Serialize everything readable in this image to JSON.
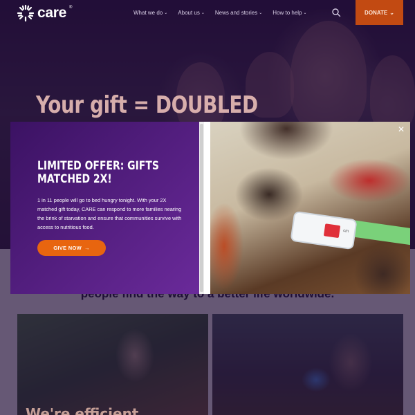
{
  "header": {
    "logo_text": "care",
    "logo_tm": "®",
    "nav": [
      {
        "label": "What we do"
      },
      {
        "label": "About us"
      },
      {
        "label": "News and stories"
      },
      {
        "label": "How to help"
      }
    ],
    "nav_caret": "⌄",
    "donate_label": "DONATE",
    "donate_caret": "⌄"
  },
  "hero": {
    "headline": "Your gift = DOUBLED"
  },
  "mission": {
    "text": "people find the way to a better life worldwide."
  },
  "cards": [
    {
      "heading": "We're efficient"
    },
    {
      "heading": ""
    }
  ],
  "modal": {
    "title": "LIMITED OFFER: GIFTS MATCHED 2X!",
    "body": "1 in 11 people will go to bed hungry tonight. With your 2X matched gift today, CARE can respond to more families nearing the brink of starvation and ensure that communities survive with access to nutritious food.",
    "cta_label": "GIVE NOW",
    "cta_arrow": "→",
    "close_glyph": "✕",
    "band_unit": "cm"
  },
  "colors": {
    "brand_purple": "#3b1263",
    "cta_orange": "#e8650f",
    "donate_orange": "#c24a12"
  },
  "icons": {
    "logo": "care-logo-icon",
    "search": "search-icon",
    "close": "close-icon",
    "arrow": "arrow-right-icon"
  }
}
